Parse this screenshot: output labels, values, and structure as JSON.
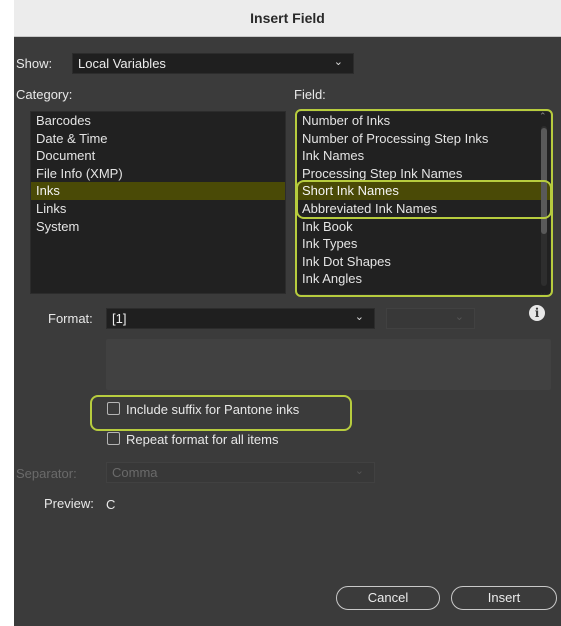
{
  "window": {
    "title": "Insert Field"
  },
  "show": {
    "label": "Show:",
    "value": "Local Variables"
  },
  "category": {
    "label": "Category:",
    "items": [
      "Barcodes",
      "Date & Time",
      "Document",
      "File Info (XMP)",
      "Inks",
      "Links",
      "System"
    ],
    "selected": "Inks"
  },
  "field": {
    "label": "Field:",
    "items": [
      "Number of Inks",
      "Number of Processing Step Inks",
      "Ink Names",
      "Processing Step Ink Names",
      "Short Ink Names",
      "Abbreviated Ink Names",
      "Ink Book",
      "Ink Types",
      "Ink Dot Shapes",
      "Ink Angles"
    ],
    "selected": "Short Ink Names"
  },
  "format": {
    "label": "Format:",
    "value": "[1]",
    "secondary_value": "",
    "info_icon": "info-icon"
  },
  "options": {
    "pantone_suffix": {
      "label": "Include suffix for Pantone inks",
      "checked": false
    },
    "repeat_format": {
      "label": "Repeat format for all items",
      "checked": false
    }
  },
  "separator": {
    "label": "Separator:",
    "value": "Comma",
    "enabled": false
  },
  "preview": {
    "label": "Preview:",
    "value": "C"
  },
  "buttons": {
    "cancel": "Cancel",
    "insert": "Insert"
  },
  "colors": {
    "highlight": "#b7cc3e",
    "selection": "#4a4a06",
    "dialog_bg": "#3b3b3b"
  }
}
